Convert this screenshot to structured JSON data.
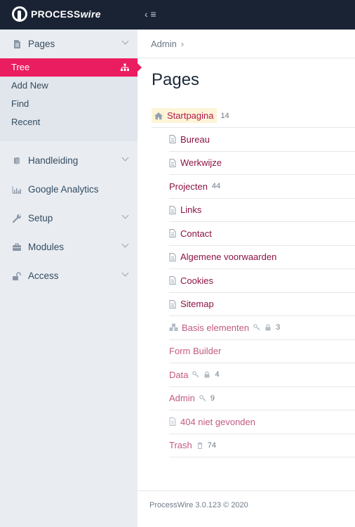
{
  "brand": {
    "name_a": "PROCESS",
    "name_b": "wire"
  },
  "topbar": {
    "toggle_label": "‹ ≡"
  },
  "sidebar": {
    "pages": {
      "label": "Pages",
      "items": [
        {
          "label": "Tree",
          "active": true
        },
        {
          "label": "Add New"
        },
        {
          "label": "Find"
        },
        {
          "label": "Recent"
        }
      ]
    },
    "sections": [
      {
        "label": "Handleiding",
        "icon": "book-icon"
      },
      {
        "label": "Google Analytics",
        "icon": "bar-chart-icon"
      },
      {
        "label": "Setup",
        "icon": "wrench-icon"
      },
      {
        "label": "Modules",
        "icon": "briefcase-icon"
      },
      {
        "label": "Access",
        "icon": "unlock-icon"
      }
    ]
  },
  "breadcrumb": {
    "item": "Admin",
    "sep": "›"
  },
  "page_title": "Pages",
  "tree": {
    "root": {
      "title": "Startpagina",
      "count": "14"
    },
    "children": [
      {
        "title": "Bureau"
      },
      {
        "title": "Werkwijze"
      },
      {
        "title": "Projecten",
        "count": "44"
      },
      {
        "title": "Links"
      },
      {
        "title": "Contact"
      },
      {
        "title": "Algemene voorwaarden"
      },
      {
        "title": "Cookies"
      },
      {
        "title": "Sitemap"
      },
      {
        "title": "Basis elementen",
        "count": "3"
      },
      {
        "title": "Form Builder"
      },
      {
        "title": "Data",
        "count": "4"
      },
      {
        "title": "Admin",
        "count": "9"
      },
      {
        "title": "404 niet gevonden"
      },
      {
        "title": "Trash",
        "count": "74"
      }
    ]
  },
  "footer": {
    "text": "ProcessWire 3.0.123 © 2020"
  },
  "colors": {
    "accent": "#eb1d61",
    "link": "#8d1245",
    "topbar": "#1a2334",
    "sidebar": "#e9edf2"
  }
}
